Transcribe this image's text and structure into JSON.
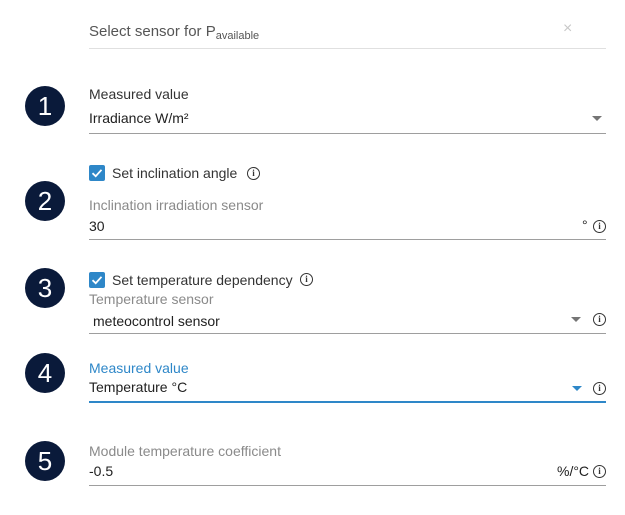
{
  "dialog": {
    "title_prefix": "Select sensor for P",
    "title_sub": "available",
    "close_symbol": "×"
  },
  "steps": [
    {
      "number": "1"
    },
    {
      "number": "2"
    },
    {
      "number": "3"
    },
    {
      "number": "4"
    },
    {
      "number": "5"
    }
  ],
  "step1": {
    "label": "Measured value",
    "value": "Irradiance W/m²"
  },
  "step2": {
    "checkbox_label": "Set inclination angle",
    "checked": true,
    "field_label": "Inclination irradiation sensor",
    "value": "30",
    "unit": "°"
  },
  "step3": {
    "checkbox_label": "Set temperature dependency",
    "checked": true,
    "field_label": "Temperature sensor",
    "value": "meteocontrol sensor"
  },
  "step4": {
    "label": "Measured value",
    "value": "Temperature °C"
  },
  "step5": {
    "field_label": "Module temperature coefficient",
    "value": "-0.5",
    "unit": "%/°C"
  },
  "icons": {
    "info": "i",
    "accent_color": "#2e87c8",
    "badge_color": "#0a1a3a"
  }
}
